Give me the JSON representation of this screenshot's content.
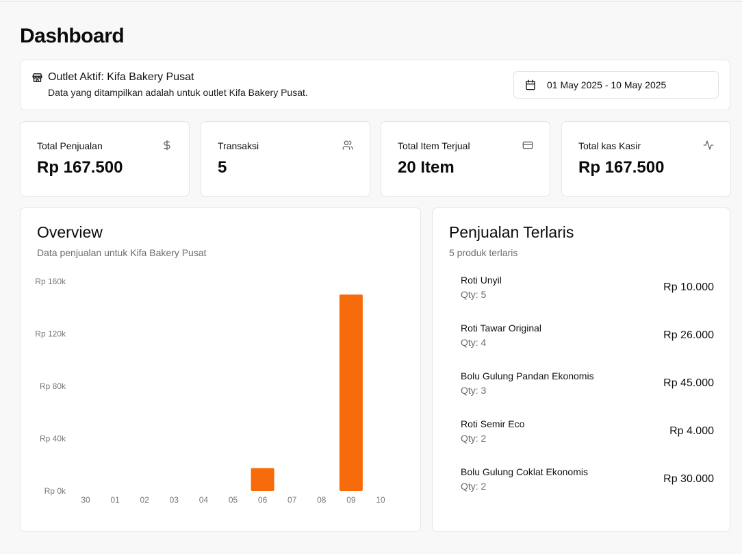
{
  "page": {
    "title": "Dashboard"
  },
  "outlet": {
    "name": "Outlet Aktif: Kifa Bakery Pusat",
    "description": "Data yang ditampilkan adalah untuk outlet Kifa Bakery Pusat.",
    "icon": "store-icon",
    "date_range": "01 May 2025 - 10 May 2025",
    "date_icon": "calendar-icon"
  },
  "stats": [
    {
      "label": "Total Penjualan",
      "value": "Rp 167.500",
      "icon": "dollar-icon"
    },
    {
      "label": "Transaksi",
      "value": "5",
      "icon": "users-icon"
    },
    {
      "label": "Total Item Terjual",
      "value": "20 Item",
      "icon": "credit-card-icon"
    },
    {
      "label": "Total kas Kasir",
      "value": "Rp 167.500",
      "icon": "activity-icon"
    }
  ],
  "overview": {
    "title": "Overview",
    "subtitle": "Data penjualan untuk Kifa Bakery Pusat"
  },
  "chart_data": {
    "type": "bar",
    "categories": [
      "30",
      "01",
      "02",
      "03",
      "04",
      "05",
      "06",
      "07",
      "08",
      "09",
      "10"
    ],
    "values": [
      0,
      0,
      0,
      0,
      0,
      0,
      17500,
      0,
      0,
      150000,
      0
    ],
    "ylim": [
      0,
      160000
    ],
    "yticks": [
      0,
      40000,
      80000,
      120000,
      160000
    ],
    "ytick_labels": [
      "Rp 0k",
      "Rp 40k",
      "Rp 80k",
      "Rp 120k",
      "Rp 160k"
    ],
    "grid": false,
    "bar_color": "#f86b0b"
  },
  "top_products": {
    "title": "Penjualan Terlaris",
    "subtitle": "5 produk terlaris",
    "items": [
      {
        "name": "Roti Unyil",
        "qty": "Qty: 5",
        "price": "Rp 10.000"
      },
      {
        "name": "Roti Tawar Original",
        "qty": "Qty: 4",
        "price": "Rp 26.000"
      },
      {
        "name": "Bolu Gulung Pandan Ekonomis",
        "qty": "Qty: 3",
        "price": "Rp 45.000"
      },
      {
        "name": "Roti Semir Eco",
        "qty": "Qty: 2",
        "price": "Rp 4.000"
      },
      {
        "name": "Bolu Gulung Coklat Ekonomis",
        "qty": "Qty: 2",
        "price": "Rp 30.000"
      }
    ]
  }
}
